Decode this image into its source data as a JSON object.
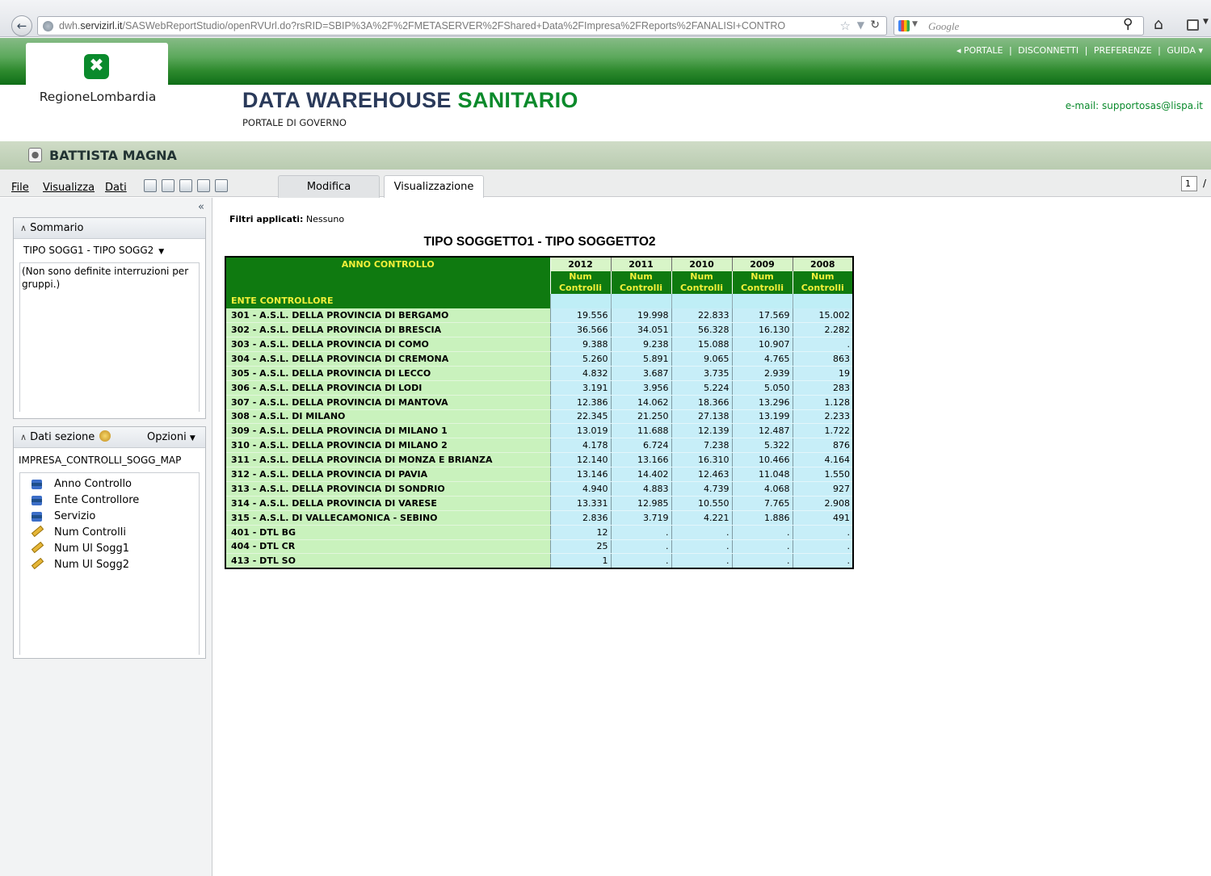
{
  "browser": {
    "url_prefix": "dwh.",
    "url_domain": "servizirl.it",
    "url_path": "/SASWebReportStudio/openRVUrl.do?rsRID=SBIP%3A%2F%2FMETASERVER%2FShared+Data%2FImpresa%2FReports%2FANALISI+CONTRO",
    "search_placeholder": "Google"
  },
  "header": {
    "top_links": [
      "◂ PORTALE",
      "DISCONNETTI",
      "PREFERENZE",
      "GUIDA ▾"
    ],
    "logo_text": "RegioneLombardia",
    "title_part1": "DATA WAREHOUSE",
    "title_part2": "SANITARIO",
    "subtitle": "PORTALE DI GOVERNO",
    "email": "e-mail: supportosas@lispa.it"
  },
  "user": {
    "name": "BATTISTA MAGNA"
  },
  "toolbar": {
    "menu": [
      "File",
      "Visualizza",
      "Dati"
    ],
    "tabs": [
      "Modifica",
      "Visualizzazione"
    ],
    "page_number": "1",
    "page_sep": "/"
  },
  "sidebar": {
    "collapse": "«",
    "sommario": {
      "title": "Sommario",
      "selected": "TIPO SOGG1 - TIPO SOGG2",
      "note": "(Non sono definite interruzioni per gruppi.)"
    },
    "dati_sezione": {
      "title": "Dati sezione",
      "options": "Opzioni",
      "source": "IMPRESA_CONTROLLI_SOGG_MAP",
      "fields": [
        {
          "label": "Anno Controllo",
          "kind": "category"
        },
        {
          "label": "Ente Controllore",
          "kind": "category"
        },
        {
          "label": "Servizio",
          "kind": "category"
        },
        {
          "label": "Num Controlli",
          "kind": "measure"
        },
        {
          "label": "Num Ul Sogg1",
          "kind": "measure"
        },
        {
          "label": "Num Ul Sogg2",
          "kind": "measure"
        }
      ]
    }
  },
  "report": {
    "filters_label": "Filtri applicati:",
    "filters_value": "Nessuno",
    "title": "TIPO SOGGETTO1 - TIPO SOGGETTO2",
    "col_header": "ANNO CONTROLLO",
    "row_header": "ENTE CONTROLLORE",
    "measure_label": "Num Controlli",
    "years": [
      "2012",
      "2011",
      "2010",
      "2009",
      "2008"
    ],
    "rows": [
      {
        "ente": "301 - A.S.L. DELLA PROVINCIA DI BERGAMO",
        "values": [
          "19.556",
          "19.998",
          "22.833",
          "17.569",
          "15.002"
        ]
      },
      {
        "ente": "302 - A.S.L. DELLA PROVINCIA DI BRESCIA",
        "values": [
          "36.566",
          "34.051",
          "56.328",
          "16.130",
          "2.282"
        ]
      },
      {
        "ente": "303 - A.S.L. DELLA PROVINCIA DI COMO",
        "values": [
          "9.388",
          "9.238",
          "15.088",
          "10.907",
          "."
        ]
      },
      {
        "ente": "304 - A.S.L. DELLA PROVINCIA DI CREMONA",
        "values": [
          "5.260",
          "5.891",
          "9.065",
          "4.765",
          "863"
        ]
      },
      {
        "ente": "305 - A.S.L. DELLA PROVINCIA DI LECCO",
        "values": [
          "4.832",
          "3.687",
          "3.735",
          "2.939",
          "19"
        ]
      },
      {
        "ente": "306 - A.S.L. DELLA PROVINCIA DI LODI",
        "values": [
          "3.191",
          "3.956",
          "5.224",
          "5.050",
          "283"
        ]
      },
      {
        "ente": "307 - A.S.L. DELLA PROVINCIA DI MANTOVA",
        "values": [
          "12.386",
          "14.062",
          "18.366",
          "13.296",
          "1.128"
        ]
      },
      {
        "ente": "308 - A.S.L. DI MILANO",
        "values": [
          "22.345",
          "21.250",
          "27.138",
          "13.199",
          "2.233"
        ]
      },
      {
        "ente": "309 - A.S.L. DELLA PROVINCIA DI MILANO 1",
        "values": [
          "13.019",
          "11.688",
          "12.139",
          "12.487",
          "1.722"
        ]
      },
      {
        "ente": "310 - A.S.L. DELLA PROVINCIA DI MILANO 2",
        "values": [
          "4.178",
          "6.724",
          "7.238",
          "5.322",
          "876"
        ]
      },
      {
        "ente": "311 - A.S.L. DELLA PROVINCIA DI MONZA E BRIANZA",
        "values": [
          "12.140",
          "13.166",
          "16.310",
          "10.466",
          "4.164"
        ]
      },
      {
        "ente": "312 - A.S.L. DELLA PROVINCIA DI PAVIA",
        "values": [
          "13.146",
          "14.402",
          "12.463",
          "11.048",
          "1.550"
        ]
      },
      {
        "ente": "313 - A.S.L. DELLA PROVINCIA DI SONDRIO",
        "values": [
          "4.940",
          "4.883",
          "4.739",
          "4.068",
          "927"
        ]
      },
      {
        "ente": "314 - A.S.L. DELLA PROVINCIA DI VARESE",
        "values": [
          "13.331",
          "12.985",
          "10.550",
          "7.765",
          "2.908"
        ]
      },
      {
        "ente": "315 - A.S.L. DI VALLECAMONICA - SEBINO",
        "values": [
          "2.836",
          "3.719",
          "4.221",
          "1.886",
          "491"
        ]
      },
      {
        "ente": "401 - DTL BG",
        "values": [
          "12",
          ".",
          ".",
          ".",
          "."
        ]
      },
      {
        "ente": "404 - DTL CR",
        "values": [
          "25",
          ".",
          ".",
          ".",
          "."
        ]
      },
      {
        "ente": "413 - DTL SO",
        "values": [
          "1",
          ".",
          ".",
          ".",
          "."
        ]
      }
    ]
  },
  "colors": {
    "brand_green": "#0b8a2b",
    "table_header_green": "#0f7a10",
    "table_header_text": "#f2ef3a",
    "row_label_bg": "#c9f2bd",
    "cell_bg": "#c7eef8"
  }
}
